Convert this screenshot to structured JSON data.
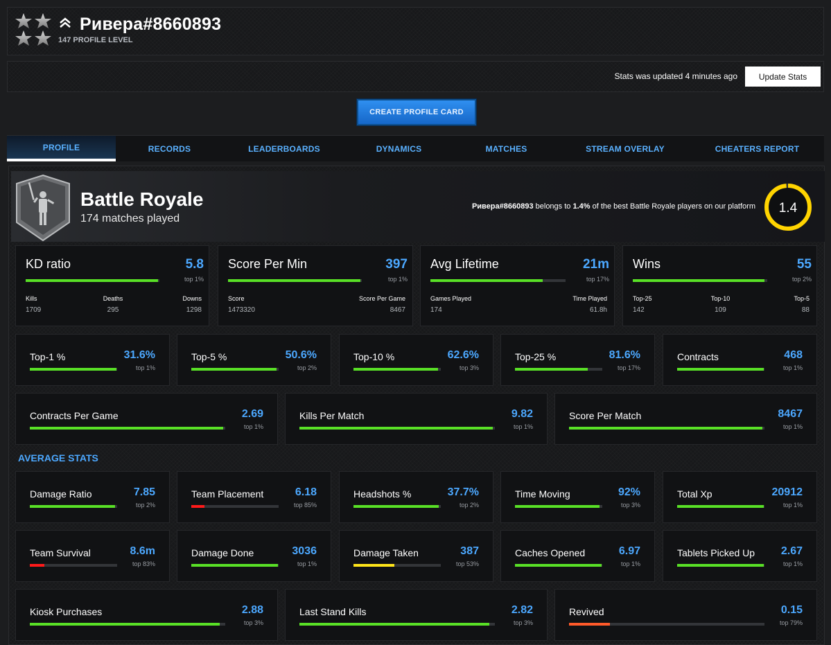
{
  "header": {
    "player_name": "Ривера#8660893",
    "level_label": "147 PROFILE LEVEL"
  },
  "update": {
    "status_text": "Stats was updated 4 minutes ago",
    "button_label": "Update Stats"
  },
  "create_card_label": "CREATE PROFILE CARD",
  "tabs": [
    {
      "label": "PROFILE",
      "active": true
    },
    {
      "label": "RECORDS"
    },
    {
      "label": "LEADERBOARDS"
    },
    {
      "label": "DYNAMICS"
    },
    {
      "label": "MATCHES"
    },
    {
      "label": "STREAM OVERLAY"
    },
    {
      "label": "CHEATERS REPORT"
    }
  ],
  "mode": {
    "title": "Battle Royale",
    "matches": "174 matches played",
    "belongs_name": "Ривера#8660893",
    "belongs_mid": " belongs to ",
    "belongs_pct": "1.4%",
    "belongs_tail": " of the best Battle Royale players on our platform",
    "rating": "1.4",
    "rating_fraction": 0.986
  },
  "colors": {
    "accent_blue": "#4ca8ff",
    "bar_green": "#59e026",
    "bar_red": "#ff1a1a",
    "bar_yellow": "#ffe51a",
    "bar_orange": "#ff5a2a",
    "ring_yellow": "#ffd400"
  },
  "primary_stats": [
    {
      "label": "KD ratio",
      "value": "5.8",
      "rank": "top 1%",
      "fill": 0.99,
      "subs": [
        {
          "label": "Kills",
          "value": "1709"
        },
        {
          "label": "Deaths",
          "value": "295"
        },
        {
          "label": "Downs",
          "value": "1298"
        }
      ]
    },
    {
      "label": "Score Per Min",
      "value": "397",
      "rank": "top 1%",
      "fill": 0.99,
      "subs": [
        {
          "label": "Score",
          "value": "1473320"
        },
        {
          "label": "Score Per Game",
          "value": "8467"
        }
      ]
    },
    {
      "label": "Avg Lifetime",
      "value": "21m",
      "rank": "top 17%",
      "fill": 0.83,
      "subs": [
        {
          "label": "Games Played",
          "value": "174"
        },
        {
          "label": "Time Played",
          "value": "61.8h"
        }
      ]
    },
    {
      "label": "Wins",
      "value": "55",
      "rank": "top 2%",
      "fill": 0.98,
      "subs": [
        {
          "label": "Top-25",
          "value": "142"
        },
        {
          "label": "Top-10",
          "value": "109"
        },
        {
          "label": "Top-5",
          "value": "88"
        }
      ]
    }
  ],
  "row1": [
    {
      "label": "Top-1 %",
      "value": "31.6%",
      "rank": "top 1%",
      "fill": 0.99
    },
    {
      "label": "Top-5 %",
      "value": "50.6%",
      "rank": "top 2%",
      "fill": 0.98
    },
    {
      "label": "Top-10 %",
      "value": "62.6%",
      "rank": "top 3%",
      "fill": 0.97
    },
    {
      "label": "Top-25 %",
      "value": "81.6%",
      "rank": "top 17%",
      "fill": 0.83
    },
    {
      "label": "Contracts",
      "value": "468",
      "rank": "top 1%",
      "fill": 0.99
    }
  ],
  "row2": [
    {
      "label": "Contracts Per Game",
      "value": "2.69",
      "rank": "top 1%",
      "fill": 0.99
    },
    {
      "label": "Kills Per Match",
      "value": "9.82",
      "rank": "top 1%",
      "fill": 0.99
    },
    {
      "label": "Score Per Match",
      "value": "8467",
      "rank": "top 1%",
      "fill": 0.99
    }
  ],
  "average_title": "AVERAGE STATS",
  "avg_row1": [
    {
      "label": "Damage Ratio",
      "value": "7.85",
      "rank": "top 2%",
      "fill": 0.98
    },
    {
      "label": "Team Placement",
      "value": "6.18",
      "rank": "top 85%",
      "fill": 0.15,
      "color": "#ff1a1a"
    },
    {
      "label": "Headshots %",
      "value": "37.7%",
      "rank": "top 2%",
      "fill": 0.98
    },
    {
      "label": "Time Moving",
      "value": "92%",
      "rank": "top 3%",
      "fill": 0.97
    },
    {
      "label": "Total Xp",
      "value": "20912",
      "rank": "top 1%",
      "fill": 0.99
    }
  ],
  "avg_row2": [
    {
      "label": "Team Survival",
      "value": "8.6m",
      "rank": "top 83%",
      "fill": 0.17,
      "color": "#ff1a1a"
    },
    {
      "label": "Damage Done",
      "value": "3036",
      "rank": "top 1%",
      "fill": 0.99
    },
    {
      "label": "Damage Taken",
      "value": "387",
      "rank": "top 53%",
      "fill": 0.47,
      "color": "#ffe51a"
    },
    {
      "label": "Caches Opened",
      "value": "6.97",
      "rank": "top 1%",
      "fill": 0.99
    },
    {
      "label": "Tablets Picked Up",
      "value": "2.67",
      "rank": "top 1%",
      "fill": 0.99
    }
  ],
  "avg_row3": [
    {
      "label": "Kiosk Purchases",
      "value": "2.88",
      "rank": "top 3%",
      "fill": 0.97
    },
    {
      "label": "Last Stand Kills",
      "value": "2.82",
      "rank": "top 3%",
      "fill": 0.97
    },
    {
      "label": "Revived",
      "value": "0.15",
      "rank": "top 79%",
      "fill": 0.21,
      "color": "#ff5a2a"
    }
  ]
}
